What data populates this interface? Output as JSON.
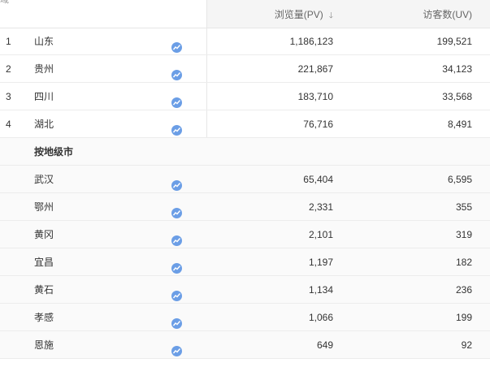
{
  "header": {
    "corner": "域",
    "pv_label": "浏览量(PV)",
    "pv_sort_icon": "sort-desc-arrow",
    "uv_label": "访客数(UV)"
  },
  "icon_color": "#6b9ee6",
  "rows": [
    {
      "index": "1",
      "name": "山东",
      "pv": "1,186,123",
      "uv": "199,521"
    },
    {
      "index": "2",
      "name": "贵州",
      "pv": "221,867",
      "uv": "34,123"
    },
    {
      "index": "3",
      "name": "四川",
      "pv": "183,710",
      "uv": "33,568"
    },
    {
      "index": "4",
      "name": "湖北",
      "pv": "76,716",
      "uv": "8,491"
    }
  ],
  "group_label": "按地级市",
  "cities": [
    {
      "name": "武汉",
      "pv": "65,404",
      "uv": "6,595"
    },
    {
      "name": "鄂州",
      "pv": "2,331",
      "uv": "355"
    },
    {
      "name": "黄冈",
      "pv": "2,101",
      "uv": "319"
    },
    {
      "name": "宜昌",
      "pv": "1,197",
      "uv": "182"
    },
    {
      "name": "黄石",
      "pv": "1,134",
      "uv": "236"
    },
    {
      "name": "孝感",
      "pv": "1,066",
      "uv": "199"
    },
    {
      "name": "恩施",
      "pv": "649",
      "uv": "92"
    }
  ]
}
